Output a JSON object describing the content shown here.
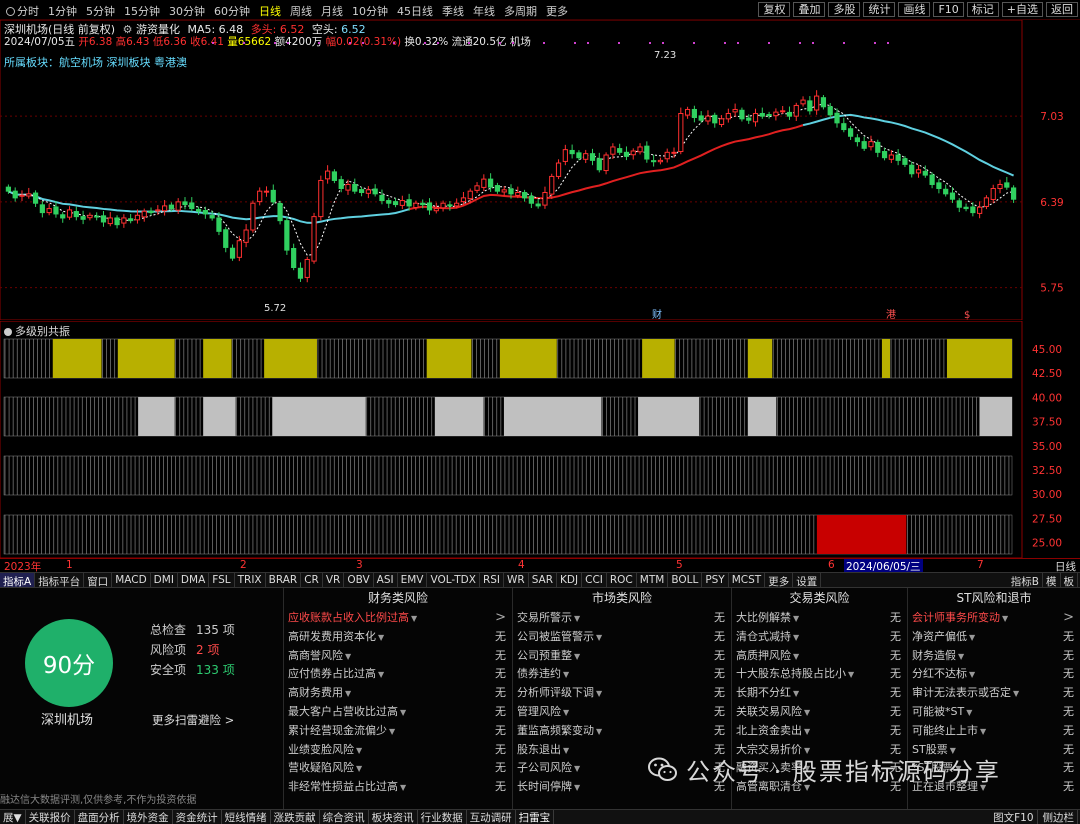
{
  "toolbar": {
    "periods": [
      "分时",
      "1分钟",
      "5分钟",
      "15分钟",
      "30分钟",
      "60分钟",
      "日线",
      "周线",
      "月线",
      "10分钟",
      "45日线",
      "季线",
      "年线",
      "多周期",
      "更多"
    ],
    "active_period": "日线",
    "tools": [
      "复权",
      "叠加",
      "多股",
      "统计",
      "画线",
      "F10",
      "标记",
      "+自选",
      "返回"
    ]
  },
  "stock": {
    "title": "深圳机场(日线 前复权)",
    "indicator": "游资量化",
    "ma5": "MA5: 6.48",
    "duo_label": "多头:",
    "duo": "6.52",
    "kong_label": "空头:",
    "kong": "6.52",
    "date": "2024/07/05五",
    "open": "开6.38",
    "high": "高6.43",
    "low": "低6.36",
    "close": "收6.41",
    "volume": "量65662",
    "amount": "额4200万",
    "change": "幅0.02(0.31%)",
    "turnover": "换0.32%",
    "float": "流通20.5亿",
    "type": "机场",
    "sector": "所属板块：航空机场 深圳板块 粤港澳"
  },
  "chart_data": {
    "type": "candlestick",
    "price_axis": [
      "7.03",
      "6.39",
      "5.75"
    ],
    "ylim": [
      5.65,
      7.3
    ],
    "marks": [
      "7.23",
      "5.72"
    ],
    "closes": [
      6.47,
      6.42,
      6.44,
      6.45,
      6.38,
      6.31,
      6.34,
      6.3,
      6.27,
      6.33,
      6.28,
      6.26,
      6.29,
      6.28,
      6.24,
      6.27,
      6.22,
      6.27,
      6.25,
      6.29,
      6.32,
      6.31,
      6.33,
      6.36,
      6.34,
      6.39,
      6.37,
      6.34,
      6.32,
      6.3,
      6.27,
      6.17,
      6.05,
      5.97,
      6.1,
      6.18,
      6.38,
      6.47,
      6.47,
      6.39,
      6.25,
      6.03,
      5.9,
      5.82,
      5.96,
      6.28,
      6.55,
      6.62,
      6.55,
      6.49,
      6.52,
      6.47,
      6.46,
      6.48,
      6.45,
      6.4,
      6.38,
      6.37,
      6.4,
      6.36,
      6.38,
      6.37,
      6.33,
      6.34,
      6.38,
      6.36,
      6.38,
      6.42,
      6.47,
      6.51,
      6.56,
      6.5,
      6.47,
      6.48,
      6.45,
      6.46,
      6.42,
      6.38,
      6.36,
      6.46,
      6.58,
      6.68,
      6.78,
      6.75,
      6.72,
      6.75,
      6.7,
      6.63,
      6.74,
      6.8,
      6.76,
      6.73,
      6.77,
      6.8,
      6.71,
      6.69,
      6.7,
      6.76,
      6.76,
      7.05,
      7.08,
      7.02,
      7.0,
      7.03,
      6.98,
      7.01,
      7.05,
      7.08,
      7.01,
      7.0,
      7.05,
      7.03,
      7.04,
      7.06,
      7.07,
      7.03,
      7.11,
      7.15,
      7.07,
      7.18,
      7.1,
      7.04,
      6.98,
      6.93,
      6.88,
      6.84,
      6.79,
      6.84,
      6.76,
      6.72,
      6.74,
      6.7,
      6.67,
      6.6,
      6.63,
      6.59,
      6.52,
      6.49,
      6.45,
      6.41,
      6.35,
      6.34,
      6.31,
      6.35,
      6.42,
      6.49,
      6.52,
      6.5,
      6.41
    ],
    "resonance_axis": [
      "45.00",
      "42.50",
      "40.00",
      "37.50",
      "35.00",
      "32.50",
      "30.00",
      "27.50",
      "25.00"
    ],
    "rows": [
      {
        "color": "#b8b000",
        "blocks": [
          [
            12,
            24
          ],
          [
            28,
            42
          ],
          [
            49,
            56
          ],
          [
            64,
            77
          ],
          [
            104,
            115
          ],
          [
            122,
            136
          ],
          [
            157,
            165
          ],
          [
            183,
            189
          ],
          [
            216,
            218
          ],
          [
            232,
            248
          ]
        ]
      },
      {
        "color": "#c0c0c0",
        "blocks": [
          [
            33,
            42
          ],
          [
            49,
            57
          ],
          [
            66,
            89
          ],
          [
            106,
            118
          ],
          [
            123,
            147
          ],
          [
            156,
            171
          ],
          [
            183,
            190
          ],
          [
            240,
            248
          ]
        ]
      },
      {
        "color": "#c0c0c0",
        "blocks": []
      },
      {
        "color": "#c80000",
        "blocks": [
          [
            200,
            222
          ]
        ]
      }
    ],
    "row_bar_count": 248
  },
  "subpanel": {
    "title": "多级别共振"
  },
  "events": [
    "财",
    "港",
    "$"
  ],
  "date_axis": {
    "labels": [
      "2023年",
      "1",
      "2",
      "3",
      "4",
      "5",
      "6",
      "7"
    ],
    "highlight": "2024/06/05/三",
    "freq": "日线"
  },
  "indicators": {
    "tabs": [
      "指标A",
      "指标平台",
      "窗口",
      "MACD",
      "DMI",
      "DMA",
      "FSL",
      "TRIX",
      "BRAR",
      "CR",
      "VR",
      "OBV",
      "ASI",
      "EMV",
      "VOL-TDX",
      "RSI",
      "WR",
      "SAR",
      "KDJ",
      "CCI",
      "ROC",
      "MTM",
      "BOLL",
      "PSY",
      "MCST",
      "更多",
      "设置"
    ],
    "right": [
      "指标B",
      "模",
      "板"
    ]
  },
  "scan": {
    "score": "90分",
    "name": "深圳机场",
    "total_label": "总检查",
    "total": "135 项",
    "risk_label": "风险项",
    "risk": "2 项",
    "safe_label": "安全项",
    "safe": "133 项",
    "more": "更多扫雷避险 >",
    "disclaimer": "融达信大数据评测,仅供参考,不作为投资依据",
    "columns": [
      {
        "title": "财务类风险",
        "rows": [
          {
            "label": "应收账款占收入比例过高",
            "result": ">",
            "hit": true
          },
          {
            "label": "高研发费用资本化",
            "result": "无"
          },
          {
            "label": "高商誉风险",
            "result": "无"
          },
          {
            "label": "应付债券占比过高",
            "result": "无"
          },
          {
            "label": "高财务费用",
            "result": "无"
          },
          {
            "label": "最大客户占营收比过高",
            "result": "无"
          },
          {
            "label": "累计经营现金流偏少",
            "result": "无"
          },
          {
            "label": "业绩变脸风险",
            "result": "无"
          },
          {
            "label": "营收疑陷风险",
            "result": "无"
          },
          {
            "label": "非经常性损益占比过高",
            "result": "无"
          }
        ]
      },
      {
        "title": "市场类风险",
        "rows": [
          {
            "label": "交易所警示",
            "result": "无"
          },
          {
            "label": "公司被监管警示",
            "result": "无"
          },
          {
            "label": "公司预重整",
            "result": "无"
          },
          {
            "label": "债券违约",
            "result": "无"
          },
          {
            "label": "分析师评级下调",
            "result": "无"
          },
          {
            "label": "管理风险",
            "result": "无"
          },
          {
            "label": "董监高频繁变动",
            "result": "无"
          },
          {
            "label": "股东退出",
            "result": "无"
          },
          {
            "label": "子公司风险",
            "result": "无"
          },
          {
            "label": "长时间停牌",
            "result": "无"
          }
        ]
      },
      {
        "title": "交易类风险",
        "rows": [
          {
            "label": "大比例解禁",
            "result": "无"
          },
          {
            "label": "清仓式减持",
            "result": "无"
          },
          {
            "label": "高质押风险",
            "result": "无"
          },
          {
            "label": "十大股东总持股占比小",
            "result": "无"
          },
          {
            "label": "长期不分红",
            "result": "无"
          },
          {
            "label": "关联交易风险",
            "result": "无"
          },
          {
            "label": "北上资金卖出",
            "result": "无"
          },
          {
            "label": "大宗交易折价",
            "result": "无"
          },
          {
            "label": "融资买入卖率",
            "result": "无"
          },
          {
            "label": "高管离职清仓",
            "result": "无"
          }
        ]
      },
      {
        "title": "ST风险和退市",
        "rows": [
          {
            "label": "会计师事务所变动",
            "result": ">",
            "hit": true
          },
          {
            "label": "净资产偏低",
            "result": "无"
          },
          {
            "label": "财务造假",
            "result": "无"
          },
          {
            "label": "分红不达标",
            "result": "无"
          },
          {
            "label": "审计无法表示或否定",
            "result": "无"
          },
          {
            "label": "可能被*ST",
            "result": "无"
          },
          {
            "label": "可能终止上市",
            "result": "无"
          },
          {
            "label": "ST股票",
            "result": "无"
          },
          {
            "label": "*ST股票",
            "result": "无"
          },
          {
            "label": "正在退市整理",
            "result": "无"
          }
        ]
      }
    ]
  },
  "watermark": "公众号 · 股票指标源码分享",
  "bottom": {
    "tabs": [
      "展▼",
      "关联报价",
      "盘面分析",
      "境外资金",
      "资金统计",
      "短线情绪",
      "涨跌贡献",
      "综合资讯",
      "板块资讯",
      "行业数据",
      "互动调研",
      "扫雷宝"
    ],
    "active": "扫雷宝",
    "right": [
      "图文F10",
      "侧边栏"
    ]
  }
}
